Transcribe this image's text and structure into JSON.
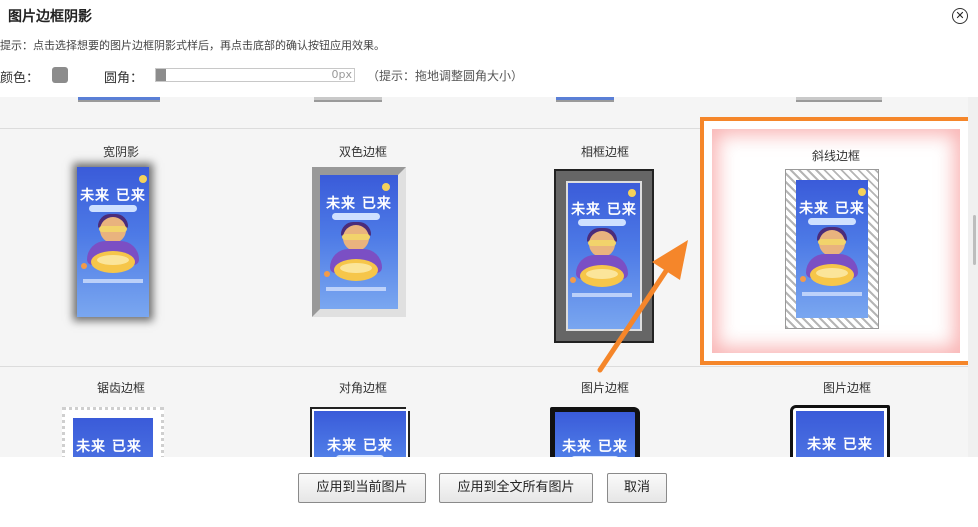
{
  "dialog": {
    "title": "图片边框阴影",
    "close_label": "✕",
    "hint": "提示：点击选择想要的图片边框阴影式样后，再点击底部的确认按钮应用效果。"
  },
  "controls": {
    "color_label": "颜色：",
    "color_value": "#8c8c8c",
    "radius_label": "圆角：",
    "radius_value": "0px",
    "radius_hint": "（提示：拖地调整圆角大小）"
  },
  "styles": {
    "row1": [
      {
        "label": "宽阴影",
        "selected": false
      },
      {
        "label": "双色边框",
        "selected": false
      },
      {
        "label": "相框边框",
        "selected": false
      },
      {
        "label": "斜线边框",
        "selected": true
      }
    ],
    "row2": [
      {
        "label": "锯齿边框"
      },
      {
        "label": "对角边框"
      },
      {
        "label": "图片边框"
      },
      {
        "label": "图片边框"
      }
    ]
  },
  "poster": {
    "title": "未来 已来"
  },
  "buttons": {
    "apply_current": "应用到当前图片",
    "apply_all": "应用到全文所有图片",
    "cancel": "取消"
  },
  "colors": {
    "selection_border": "#f5862a",
    "selection_glow": "#f47878",
    "poster_blue": "#3a5bd9"
  }
}
